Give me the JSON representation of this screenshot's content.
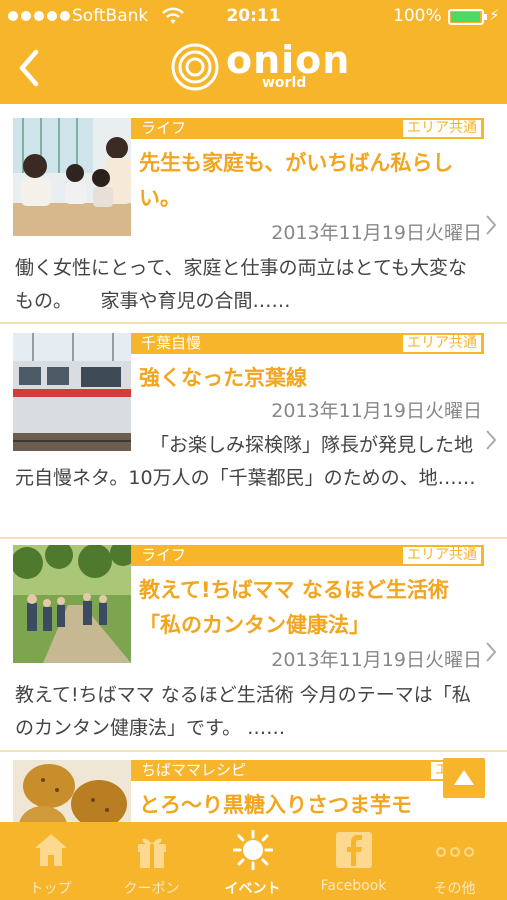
{
  "status_bar": {
    "carrier": "SoftBank",
    "time": "20:11",
    "battery": "100%"
  },
  "header": {
    "logo_name": "onion",
    "logo_sub": "world"
  },
  "articles": [
    {
      "category": "ライフ",
      "area": "エリア共通",
      "title": "先生も家庭も、がいちばん私らしい。",
      "date": "2013年11月19日火曜日",
      "description": "働く女性にとって、家庭と仕事の両立はとても大変なもの。　　家事や育児の合間……"
    },
    {
      "category": "千葉自慢",
      "area": "エリア共通",
      "title": "強くなった京葉線",
      "date": "2013年11月19日火曜日",
      "description": "「お楽しみ探検隊」隊長が発見した地元自慢ネタ。10万人の「千葉都民」のための、地……"
    },
    {
      "category": "ライフ",
      "area": "エリア共通",
      "title": "教えて!ちばママ なるほど生活術「私のカンタン健康法」",
      "date": "2013年11月19日火曜日",
      "description": "教えて!ちばママ なるほど生活術 今月のテーマは「私のカンタン健康法」です。 ……"
    },
    {
      "category": "ちばママレシピ",
      "area": "エリア",
      "title": "とろ〜り黒糖入りさつま芋モ"
    }
  ],
  "tabs": [
    {
      "label": "トップ",
      "icon": "home-icon"
    },
    {
      "label": "クーポン",
      "icon": "gift-icon"
    },
    {
      "label": "イベント",
      "icon": "sun-icon"
    },
    {
      "label": "Facebook",
      "icon": "facebook-icon"
    },
    {
      "label": "その他",
      "icon": "more-icon"
    }
  ],
  "colors": {
    "brand": "#f7b52c",
    "title": "#f2a51e"
  }
}
